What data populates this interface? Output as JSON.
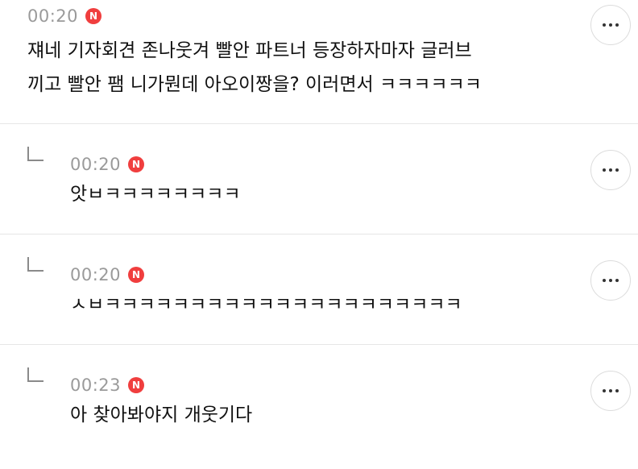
{
  "comments": [
    {
      "time": "00:20",
      "badge": "N",
      "lines": [
        "쟤네 기자회견 존나웃겨 빨안 파트너 등장하자마자 글러브",
        "끼고 빨안 팸 니가뭔데 아오이짱을? 이러면서 ㅋㅋㅋㅋㅋㅋ"
      ]
    },
    {
      "time": "00:20",
      "badge": "N",
      "text": "앗ㅂㅋㅋㅋㅋㅋㅋㅋㅋ"
    },
    {
      "time": "00:20",
      "badge": "N",
      "text": "ㅅㅂㅋㅋㅋㅋㅋㅋㅋㅋㅋㅋㅋㅋㅋㅋㅋㅋㅋㅋㅋㅋㅋ"
    },
    {
      "time": "00:23",
      "badge": "N",
      "text": "아 찾아봐야지 개웃기다"
    }
  ],
  "icons": {
    "new_badge": "n-badge-icon",
    "reply_marker": "reply-corner-icon",
    "more": "more-dots-icon"
  },
  "colors": {
    "badge": "#f03e3e",
    "time": "#9a9a9a",
    "divider": "#e6e6e6"
  }
}
